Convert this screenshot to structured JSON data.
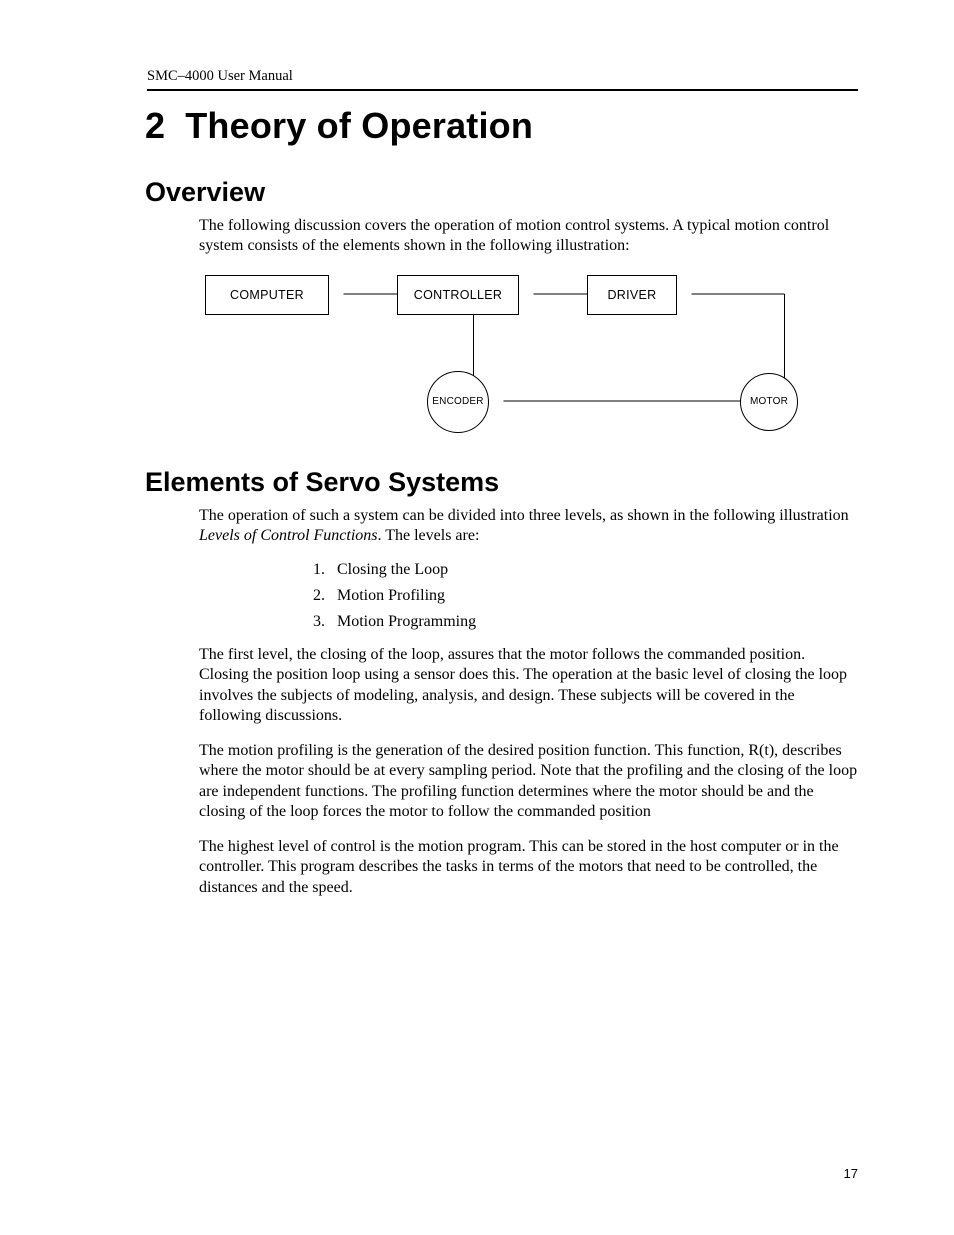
{
  "running_head": "SMC–4000 User Manual",
  "page_number": "17",
  "chapter": {
    "number": "2",
    "title": "Theory of Operation"
  },
  "overview": {
    "heading": "Overview",
    "p1": "The following discussion covers the operation of motion control systems. A typical motion control system consists of the elements shown in the following illustration:"
  },
  "diagram": {
    "boxes": {
      "computer": "COMPUTER",
      "controller": "CONTROLLER",
      "driver": "DRIVER"
    },
    "circles": {
      "encoder": "ENCODER",
      "motor": "MOTOR"
    }
  },
  "servo": {
    "heading": "Elements of Servo Systems",
    "p1a": "The operation of such a system can be divided into three levels, as shown in the following illustration ",
    "p1b": "Levels of Control Functions",
    "p1c": ". The levels are:",
    "levels": [
      "Closing the Loop",
      "Motion Profiling",
      "Motion Programming"
    ],
    "p2": "The first level, the closing of the loop, assures that the motor follows the commanded position. Closing the position loop using a sensor does this. The operation at the basic level of closing the loop involves the subjects of modeling, analysis, and design. These subjects will be covered in the following discussions.",
    "p3": "The motion profiling is the generation of the desired position function. This function, R(t), describes where the motor should be at every sampling period. Note that the profiling and the closing of the loop are independent functions. The profiling function determines where the motor should be and the closing of the loop forces the motor to follow the commanded position",
    "p4": "The highest level of control is the motion program. This can be stored in the host computer or in the controller. This program describes the tasks in terms of the motors that need to be controlled, the distances and the speed."
  }
}
